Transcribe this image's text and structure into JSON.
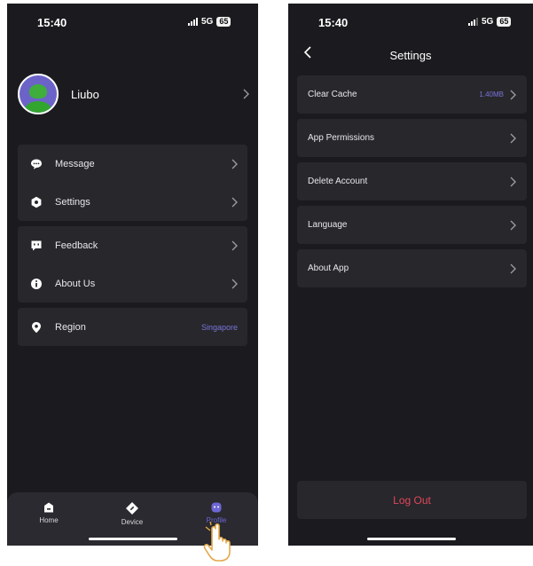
{
  "left_screen": {
    "status": {
      "time": "15:40",
      "network": "5G",
      "battery": "65"
    },
    "profile": {
      "name": "Liubo"
    },
    "menu_groups": [
      [
        {
          "label": "Message",
          "icon": "message-icon"
        },
        {
          "label": "Settings",
          "icon": "settings-icon"
        }
      ],
      [
        {
          "label": "Feedback",
          "icon": "feedback-icon"
        },
        {
          "label": "About Us",
          "icon": "info-icon"
        }
      ],
      [
        {
          "label": "Region",
          "icon": "location-icon",
          "value": "Singapore"
        }
      ]
    ],
    "tabs": [
      {
        "label": "Home",
        "icon": "home-icon"
      },
      {
        "label": "Device",
        "icon": "device-icon"
      },
      {
        "label": "Profile",
        "icon": "profile-icon",
        "active": true
      }
    ]
  },
  "right_screen": {
    "status": {
      "time": "15:40",
      "network": "5G",
      "battery": "65"
    },
    "title": "Settings",
    "items": [
      {
        "label": "Clear Cache",
        "value": "1.40MB"
      },
      {
        "label": "App Permissions"
      },
      {
        "label": "Delete Account"
      },
      {
        "label": "Language"
      },
      {
        "label": "About App"
      }
    ],
    "logout_label": "Log Out"
  },
  "colors": {
    "background": "#1b1b1f",
    "card": "#27272c",
    "accent": "#6d67d6",
    "danger": "#e0485a"
  }
}
